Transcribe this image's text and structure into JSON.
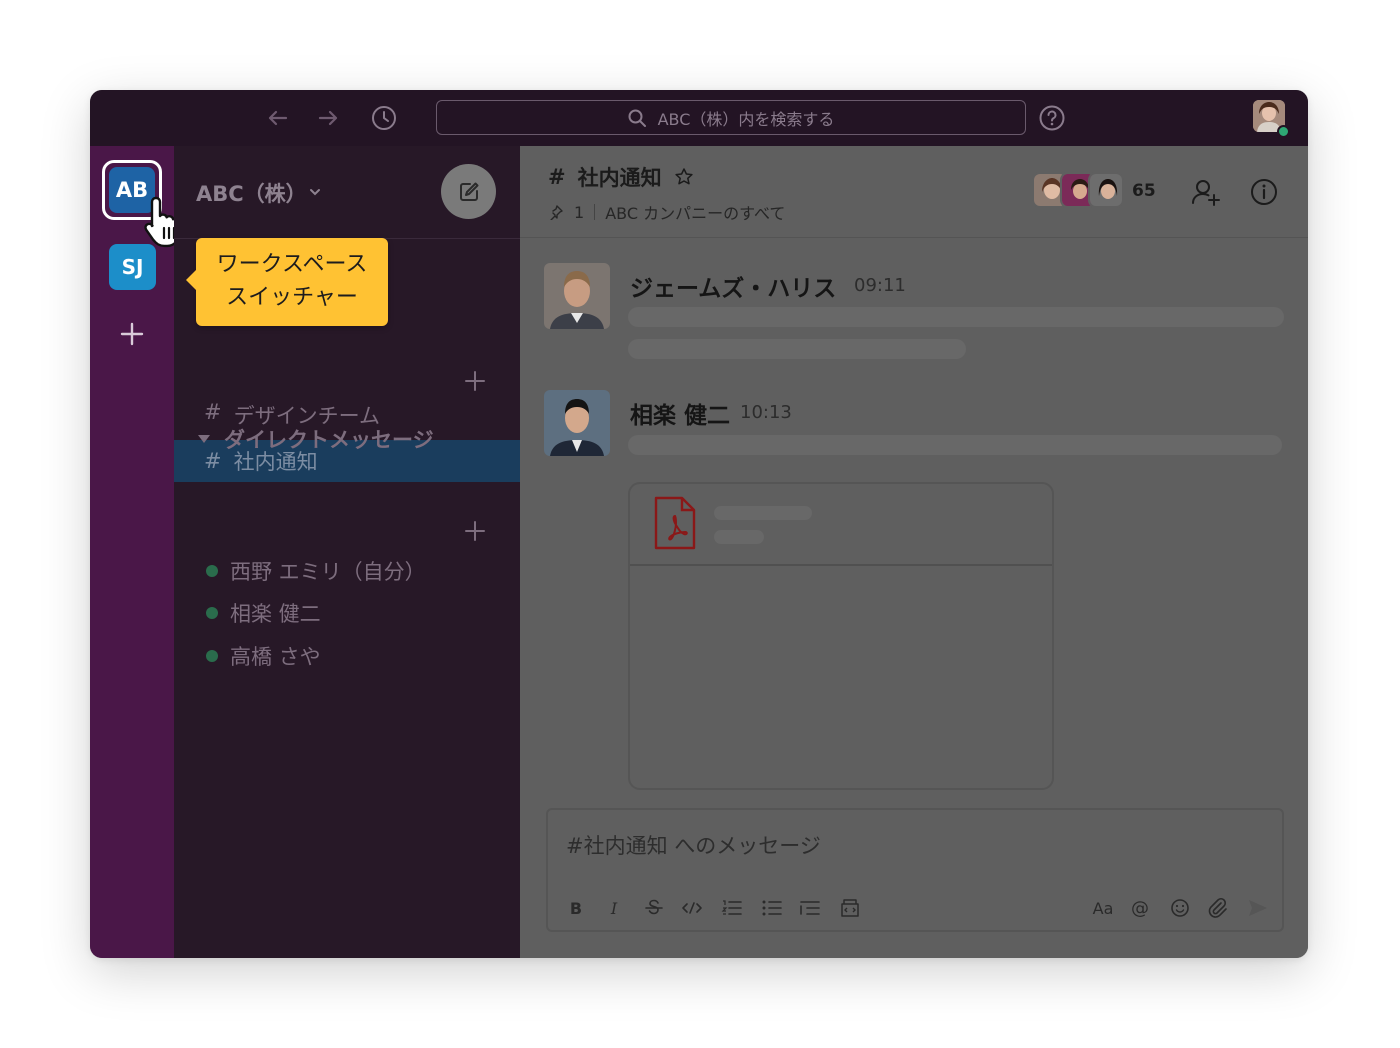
{
  "topbar": {
    "search_placeholder": "ABC（株）内を検索する",
    "back_icon": "arrow-left-icon",
    "forward_icon": "arrow-right-icon",
    "history_icon": "clock-icon",
    "help_icon": "question-icon"
  },
  "workspaces": {
    "items": [
      {
        "initials": "AB",
        "color": "#1e63a5",
        "selected": true
      },
      {
        "initials": "SJ",
        "color": "#1c8ec9",
        "selected": false
      }
    ]
  },
  "tooltip": {
    "line1": "ワークスペース",
    "line2": "スイッチャー"
  },
  "sidebar": {
    "workspace_name": "ABC（株）",
    "channels": [
      {
        "label": "デザインチーム"
      },
      {
        "label": "社内通知",
        "active": true
      }
    ],
    "hash": "#",
    "dm_header": "ダイレクトメッセージ",
    "dms": [
      {
        "label": "西野 エミリ（自分）"
      },
      {
        "label": "相楽 健二"
      },
      {
        "label": "高橋 さや"
      }
    ]
  },
  "channel": {
    "hash": "#",
    "name": "社内通知",
    "pinned_count": "1",
    "description": "ABC カンパニーのすべて",
    "member_count": "65"
  },
  "messages": [
    {
      "author": "ジェームズ・ハリス",
      "time": "09:11"
    },
    {
      "author": "相楽 健二",
      "time": "10:13"
    }
  ],
  "composer": {
    "placeholder": "#社内通知 へのメッセージ",
    "bold": "B",
    "italic": "I",
    "text_size": "Aa",
    "mention": "@"
  },
  "colors": {
    "topbar": "#231424",
    "rail": "#4a1748",
    "sidebar": "#271827",
    "tooltip": "#ffc233",
    "active_channel": "#1a3d5d",
    "presence": "#2ea874"
  }
}
